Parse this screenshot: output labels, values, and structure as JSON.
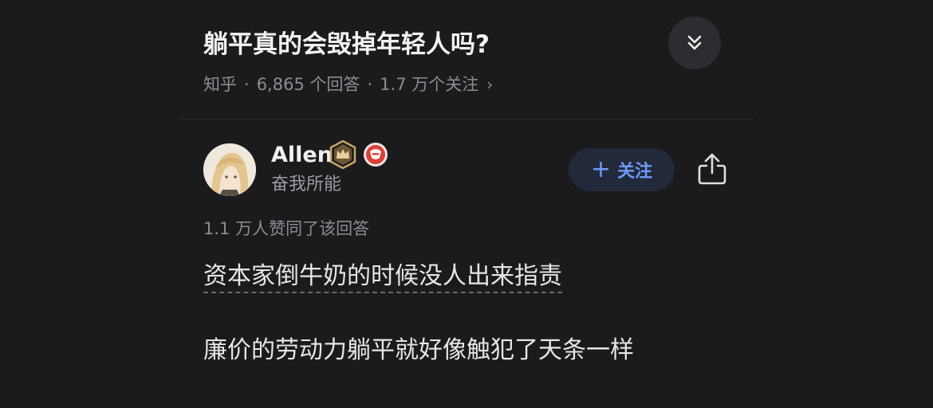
{
  "question": {
    "title": "躺平真的会毁掉年轻人吗?",
    "source": "知乎",
    "answers": "6,865 个回答",
    "followers": "1.7 万个关注",
    "separator": "·",
    "chevron": "›"
  },
  "collapse_icon": "double-chevron-down-icon",
  "answer": {
    "author": {
      "name": "Allen",
      "bio": "奋我所能",
      "badges": [
        "crown-badge-icon",
        "red-medal-icon"
      ],
      "badge_colors": [
        "#c8a467",
        "#d9413a"
      ]
    },
    "follow": {
      "plus": "+",
      "label": "关注",
      "color": "#6e9af5"
    },
    "share_icon": "share-icon",
    "votes": "1.1 万人赞同了该回答",
    "paragraphs": [
      "资本家倒牛奶的时候没人出来指责",
      "廉价的劳动力躺平就好像触犯了天条一样"
    ]
  }
}
